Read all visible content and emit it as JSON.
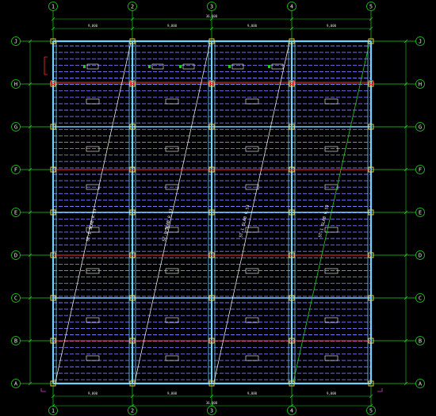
{
  "drawing": {
    "column_axes": [
      "1",
      "2",
      "3",
      "4",
      "5"
    ],
    "row_axes": [
      "J",
      "H",
      "G",
      "F",
      "E",
      "D",
      "C",
      "B",
      "A"
    ],
    "top_bay_dims": [
      "9,000",
      "9,000",
      "9,000",
      "9,000"
    ],
    "top_total_dim": "36,000",
    "bottom_bay_dims": [
      "9,000",
      "9,000",
      "9,000",
      "9,000"
    ],
    "bottom_total_dim": "36,000",
    "bay_notes": [
      "ST-1 SLAB 0.53",
      "ST-1 SLAB 0.53",
      "ST-1 SLAB 0.53",
      "ST-1 SLAB 0.53"
    ],
    "colors": {
      "background": "#000000",
      "grid_line": "#22cc22",
      "beam": "#6fd3ff",
      "purlin": "#7a7aff",
      "bracing": "#ff3030",
      "column": "#ffd84a",
      "text": "#ffffff"
    }
  }
}
